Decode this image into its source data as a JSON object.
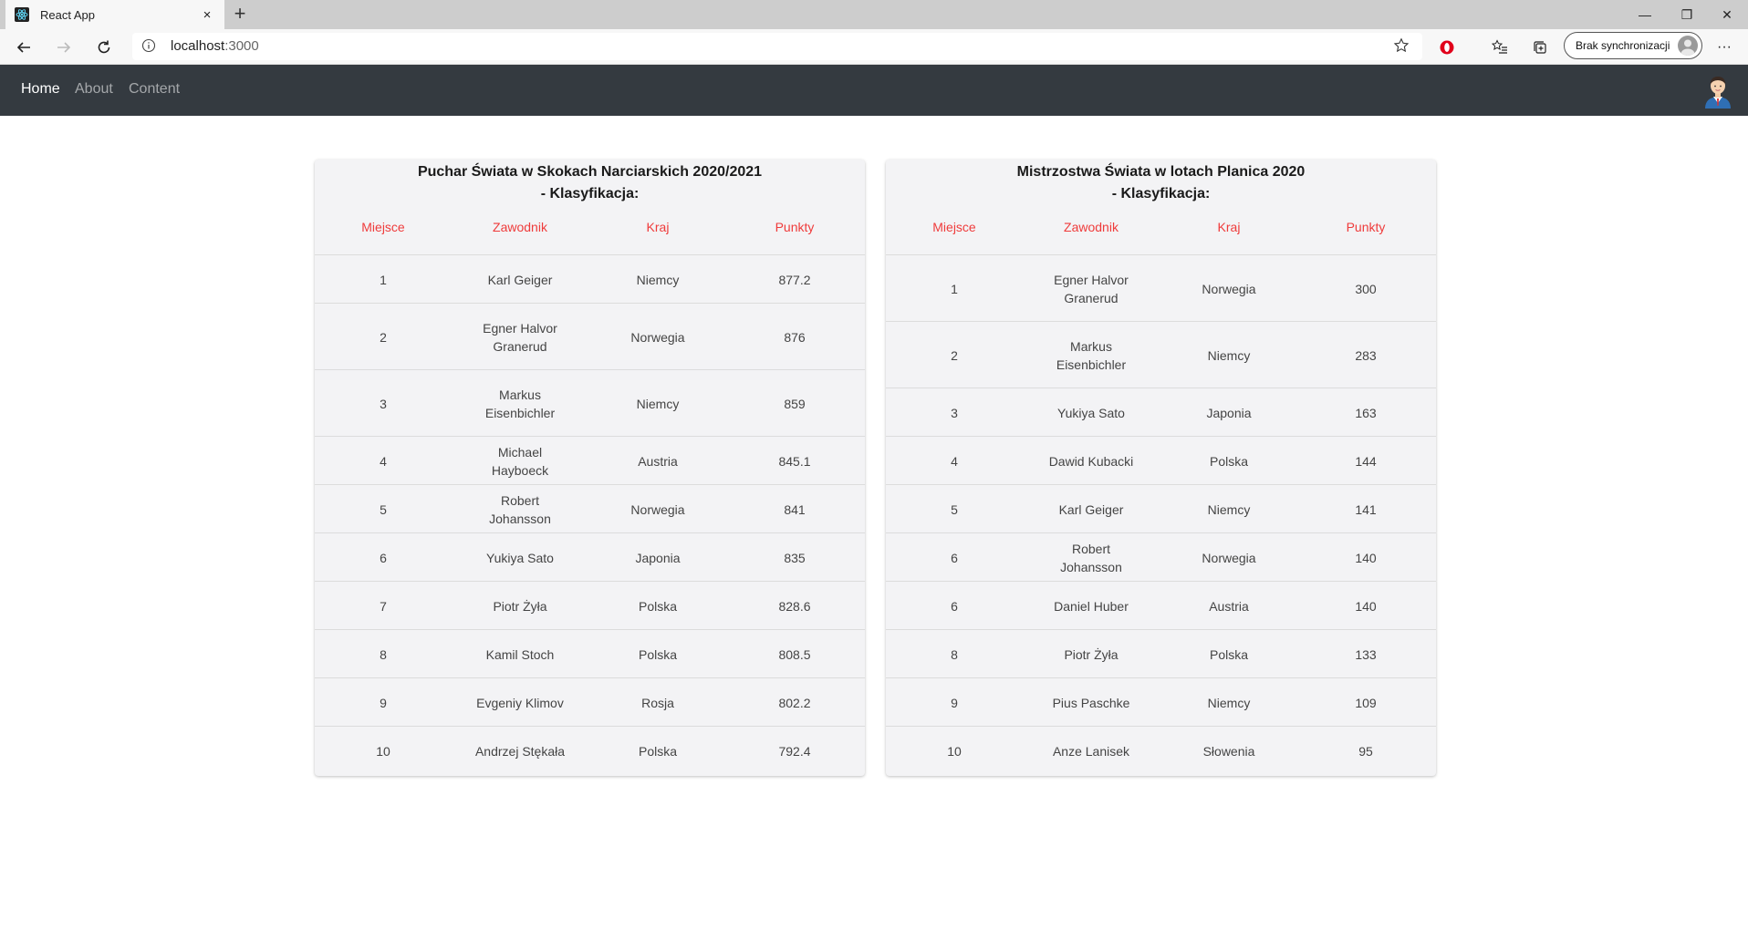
{
  "browser": {
    "tab_title": "React App",
    "tab_close": "×",
    "new_tab": "+",
    "url_host": "localhost",
    "url_port": ":3000",
    "sync_label": "Brak synchronizacji",
    "more": "···",
    "window_controls": {
      "minimize": "—",
      "restore": "❐",
      "close": "✕"
    }
  },
  "navbar": {
    "links": [
      "Home",
      "About",
      "Content"
    ],
    "active": "Home"
  },
  "tables": [
    {
      "title_line1": "Puchar Świata w Skokach Narciarskich 2020/2021",
      "title_line2": "- Klasyfikacja:",
      "headers": [
        "Miejsce",
        "Zawodnik",
        "Kraj",
        "Punkty"
      ],
      "rows": [
        [
          "1",
          "Karl Geiger",
          "Niemcy",
          "877.2"
        ],
        [
          "2",
          "Egner Halvor Granerud",
          "Norwegia",
          "876"
        ],
        [
          "3",
          "Markus Eisenbichler",
          "Niemcy",
          "859"
        ],
        [
          "4",
          "Michael Hayboeck",
          "Austria",
          "845.1"
        ],
        [
          "5",
          "Robert Johansson",
          "Norwegia",
          "841"
        ],
        [
          "6",
          "Yukiya Sato",
          "Japonia",
          "835"
        ],
        [
          "7",
          "Piotr Żyła",
          "Polska",
          "828.6"
        ],
        [
          "8",
          "Kamil Stoch",
          "Polska",
          "808.5"
        ],
        [
          "9",
          "Evgeniy Klimov",
          "Rosja",
          "802.2"
        ],
        [
          "10",
          "Andrzej Stękała",
          "Polska",
          "792.4"
        ]
      ]
    },
    {
      "title_line1": "Mistrzostwa Świata w lotach Planica 2020",
      "title_line2": "- Klasyfikacja:",
      "headers": [
        "Miejsce",
        "Zawodnik",
        "Kraj",
        "Punkty"
      ],
      "rows": [
        [
          "1",
          "Egner Halvor Granerud",
          "Norwegia",
          "300"
        ],
        [
          "2",
          "Markus Eisenbichler",
          "Niemcy",
          "283"
        ],
        [
          "3",
          "Yukiya Sato",
          "Japonia",
          "163"
        ],
        [
          "4",
          "Dawid Kubacki",
          "Polska",
          "144"
        ],
        [
          "5",
          "Karl Geiger",
          "Niemcy",
          "141"
        ],
        [
          "6",
          "Robert Johansson",
          "Norwegia",
          "140"
        ],
        [
          "6",
          "Daniel Huber",
          "Austria",
          "140"
        ],
        [
          "8",
          "Piotr Żyła",
          "Polska",
          "133"
        ],
        [
          "9",
          "Pius Paschke",
          "Niemcy",
          "109"
        ],
        [
          "10",
          "Anze Lanisek",
          "Słowenia",
          "95"
        ]
      ]
    }
  ]
}
